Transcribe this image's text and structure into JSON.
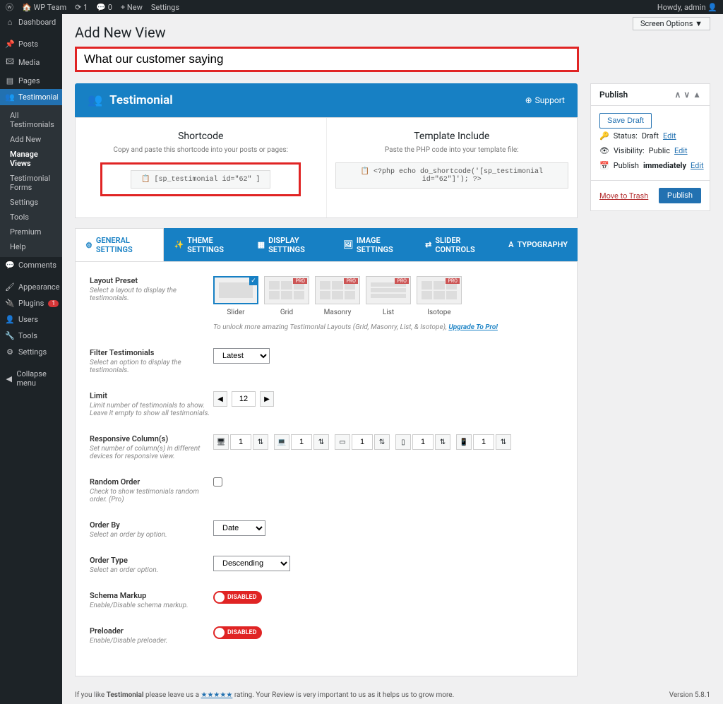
{
  "adminbar": {
    "site": "WP Team",
    "updates": "1",
    "comments": "0",
    "new": "New",
    "settings": "Settings",
    "howdy": "Howdy, admin"
  },
  "screen_options": "Screen Options ▼",
  "page_title": "Add New View",
  "title_value": "What our customer saying",
  "sidemenu": {
    "dashboard": "Dashboard",
    "posts": "Posts",
    "media": "Media",
    "pages": "Pages",
    "testimonial": "Testimonial",
    "sub_all": "All Testimonials",
    "sub_add": "Add New",
    "sub_manage": "Manage Views",
    "sub_forms": "Testimonial Forms",
    "sub_settings": "Settings",
    "sub_tools": "Tools",
    "sub_premium": "Premium",
    "sub_help": "Help",
    "comments": "Comments",
    "appearance": "Appearance",
    "plugins": "Plugins",
    "plugins_count": "1",
    "users": "Users",
    "tools": "Tools",
    "settings": "Settings",
    "collapse": "Collapse menu"
  },
  "plugin": {
    "title": "Testimonial",
    "support": "Support"
  },
  "shortcode": {
    "h1": "Shortcode",
    "p1": "Copy and paste this shortcode into your posts or pages:",
    "code1": "[sp_testimonial id=\"62\" ]",
    "h2": "Template Include",
    "p2": "Paste the PHP code into your template file:",
    "code2": "<?php echo do_shortcode('[sp_testimonial id=\"62\"]'); ?>"
  },
  "tabs": {
    "general": "GENERAL SETTINGS",
    "theme": "THEME SETTINGS",
    "display": "DISPLAY SETTINGS",
    "image": "IMAGE SETTINGS",
    "slider": "SLIDER CONTROLS",
    "typo": "TYPOGRAPHY"
  },
  "settings": {
    "layout_preset": {
      "label": "Layout Preset",
      "desc": "Select a layout to display the testimonials."
    },
    "layouts": {
      "slider": "Slider",
      "grid": "Grid",
      "masonry": "Masonry",
      "list": "List",
      "isotope": "Isotope"
    },
    "upgrade_note": "To unlock more amazing Testimonial Layouts (Grid, Masonry, List, & Isotope),",
    "upgrade_link": "Upgrade To Pro!",
    "filter": {
      "label": "Filter Testimonials",
      "desc": "Select an option to display the testimonials.",
      "value": "Latest"
    },
    "limit": {
      "label": "Limit",
      "desc": "Limit number of testimonials to show. Leave it empty to show all testimonials.",
      "value": "12"
    },
    "resp": {
      "label": "Responsive Column(s)",
      "desc": "Set number of column(s) in different devices for responsive view.",
      "v": "1"
    },
    "random": {
      "label": "Random Order",
      "desc": "Check to show testimonials random order. (Pro)"
    },
    "orderby": {
      "label": "Order By",
      "desc": "Select an order by option.",
      "value": "Date"
    },
    "ordertype": {
      "label": "Order Type",
      "desc": "Select an order option.",
      "value": "Descending"
    },
    "schema": {
      "label": "Schema Markup",
      "desc": "Enable/Disable schema markup.",
      "value": "DISABLED"
    },
    "preloader": {
      "label": "Preloader",
      "desc": "Enable/Disable preloader.",
      "value": "DISABLED"
    }
  },
  "publish": {
    "title": "Publish",
    "save_draft": "Save Draft",
    "status_lbl": "Status:",
    "status_val": "Draft",
    "visibility_lbl": "Visibility:",
    "visibility_val": "Public",
    "publish_lbl": "Publish",
    "publish_val": "immediately",
    "edit": "Edit",
    "trash": "Move to Trash",
    "publish_btn": "Publish"
  },
  "footer": {
    "text1": "If you like",
    "text2": "Testimonial",
    "text3": "please leave us a",
    "stars": "★★★★★",
    "text4": "rating. Your Review is very important to us as it helps us to grow more.",
    "version": "Version 5.8.1"
  }
}
